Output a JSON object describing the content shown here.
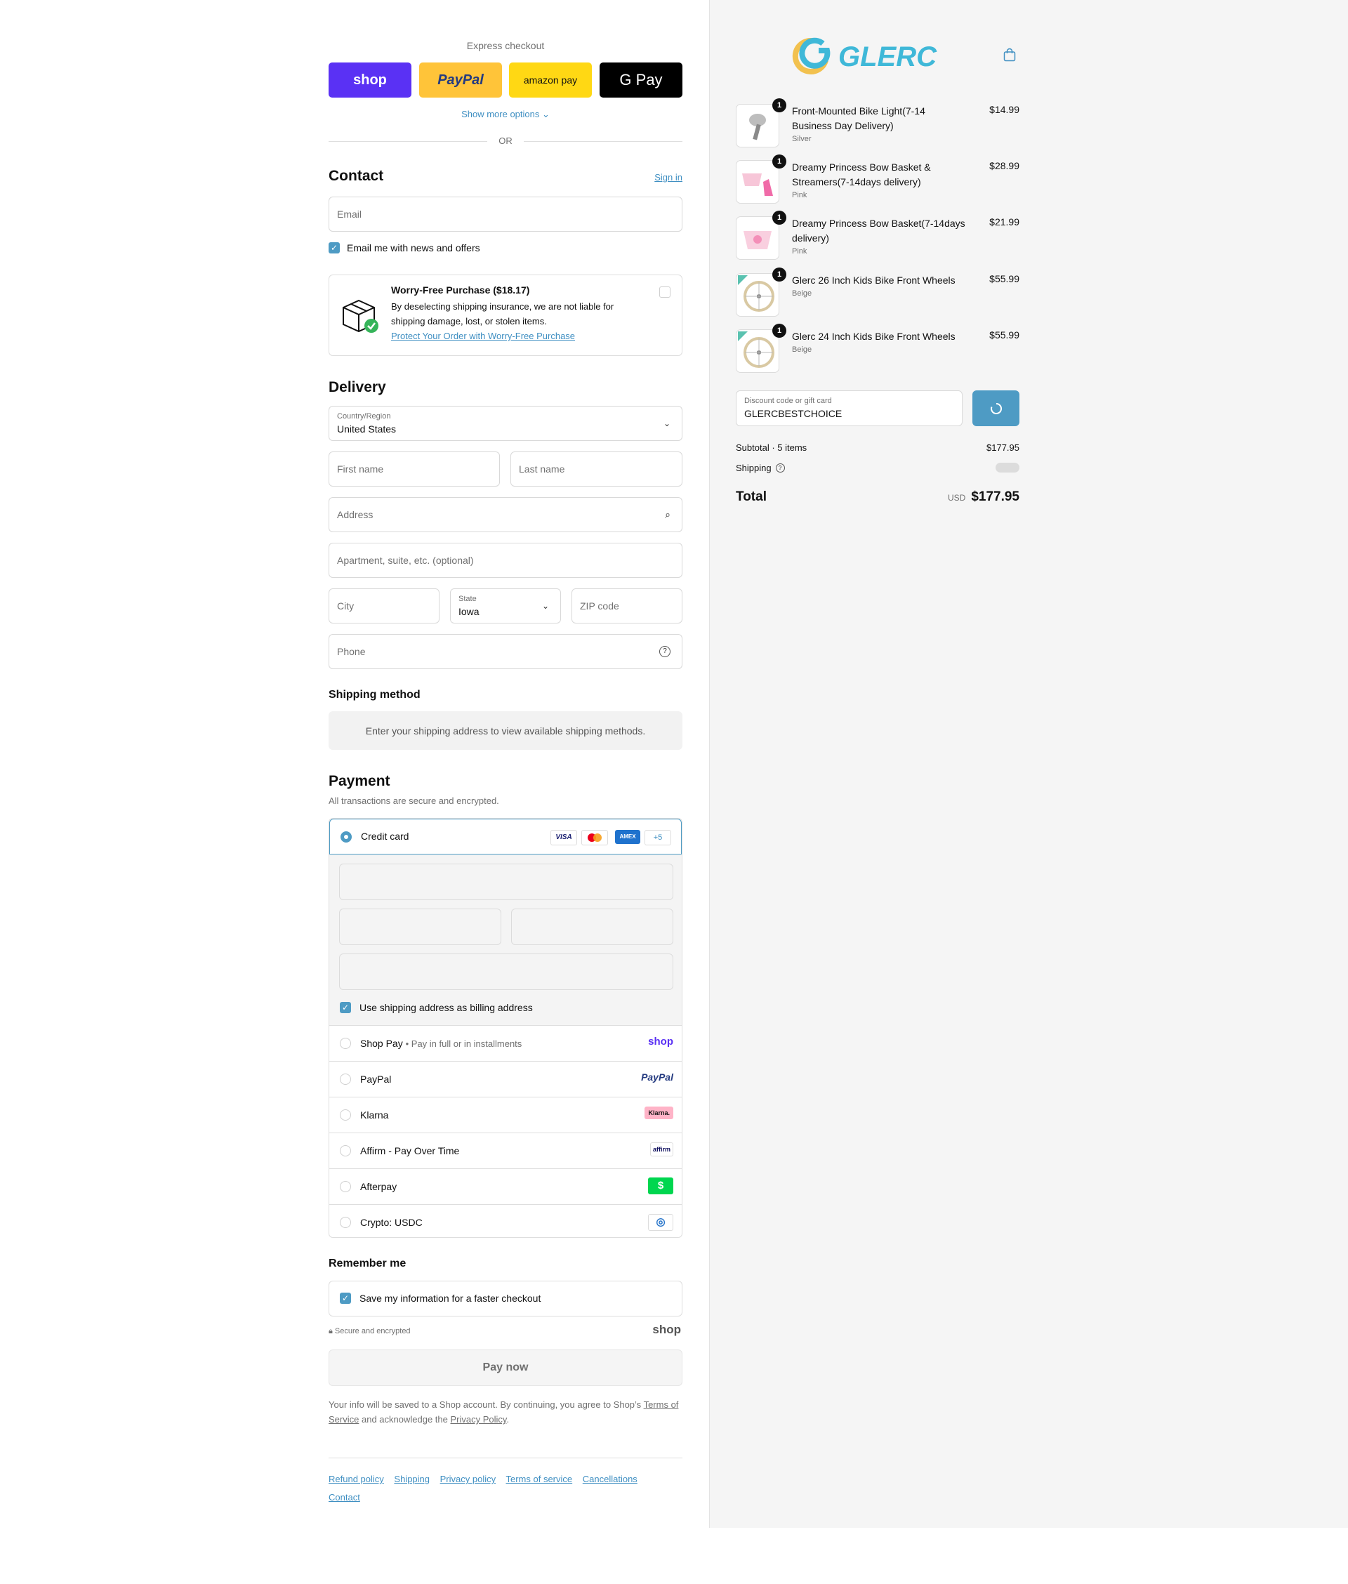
{
  "express": {
    "title": "Express checkout",
    "shop_label": "shop",
    "paypal_label": "PayPal",
    "amazon_label": "amazon pay",
    "gpay_label": "G Pay",
    "show_more": "Show more options",
    "or": "OR"
  },
  "contact": {
    "heading": "Contact",
    "sign_in": "Sign in",
    "email_placeholder": "Email",
    "news_label": "Email me with news and offers"
  },
  "worry_free": {
    "title": "Worry-Free Purchase ($18.17)",
    "desc": "By deselecting shipping insurance, we are not liable for shipping damage, lost, or stolen items.",
    "link": "Protect Your Order with Worry-Free Purchase"
  },
  "delivery": {
    "heading": "Delivery",
    "country_label": "Country/Region",
    "country_value": "United States",
    "first_name": "First name",
    "last_name": "Last name",
    "address": "Address",
    "apartment": "Apartment, suite, etc. (optional)",
    "city": "City",
    "state_label": "State",
    "state_value": "Iowa",
    "zip": "ZIP code",
    "phone": "Phone"
  },
  "shipping_method": {
    "heading": "Shipping method",
    "message": "Enter your shipping address to view available shipping methods."
  },
  "payment": {
    "heading": "Payment",
    "subtitle": "All transactions are secure and encrypted.",
    "credit_card": "Credit card",
    "card_logos": [
      "VISA",
      "MC",
      "AMEX",
      "+5"
    ],
    "billing_label": "Use shipping address as billing address",
    "methods": [
      {
        "label": "Shop Pay",
        "sub": "Pay in full or in installments",
        "logo": "shop"
      },
      {
        "label": "PayPal",
        "sub": "",
        "logo": "PayPal"
      },
      {
        "label": "Klarna",
        "sub": "",
        "logo": "Klarna."
      },
      {
        "label": "Affirm - Pay Over Time",
        "sub": "",
        "logo": "affirm"
      },
      {
        "label": "Afterpay",
        "sub": "",
        "logo": "$"
      },
      {
        "label": "Crypto: USDC",
        "sub": "",
        "logo": "◎"
      }
    ]
  },
  "remember": {
    "heading": "Remember me",
    "save_label": "Save my information for a faster checkout",
    "secure": "Secure and encrypted",
    "shop_logo": "shop"
  },
  "pay_now": "Pay now",
  "legal": {
    "text1": "Your info will be saved to a Shop account. By continuing, you agree to Shop’s",
    "tos": "Terms of Service",
    "text2": "and acknowledge the",
    "privacy": "Privacy Policy",
    "text3": "."
  },
  "footer": [
    "Refund policy",
    "Shipping",
    "Privacy policy",
    "Terms of service",
    "Cancellations",
    "Contact"
  ],
  "brand": {
    "name": "GLERC",
    "accent": "#3fb8d8",
    "accent2": "#f2c14e"
  },
  "cart": {
    "items": [
      {
        "qty": "1",
        "name": "Front-Mounted Bike Light(7-14 Business Day Delivery)",
        "variant": "Silver",
        "price": "$14.99"
      },
      {
        "qty": "1",
        "name": "Dreamy Princess Bow Basket & Streamers(7-14days delivery)",
        "variant": "Pink",
        "price": "$28.99"
      },
      {
        "qty": "1",
        "name": "Dreamy Princess Bow Basket(7-14days delivery)",
        "variant": "Pink",
        "price": "$21.99"
      },
      {
        "qty": "1",
        "name": "Glerc 26 Inch Kids Bike Front Wheels",
        "variant": "Beige",
        "price": "$55.99"
      },
      {
        "qty": "1",
        "name": "Glerc 24 Inch Kids Bike Front Wheels",
        "variant": "Beige",
        "price": "$55.99"
      }
    ],
    "discount_label": "Discount code or gift card",
    "discount_value": "GLERCBESTCHOICE",
    "subtotal_label": "Subtotal · 5 items",
    "subtotal_value": "$177.95",
    "shipping_label": "Shipping",
    "total_label": "Total",
    "currency": "USD",
    "total_value": "$177.95"
  }
}
